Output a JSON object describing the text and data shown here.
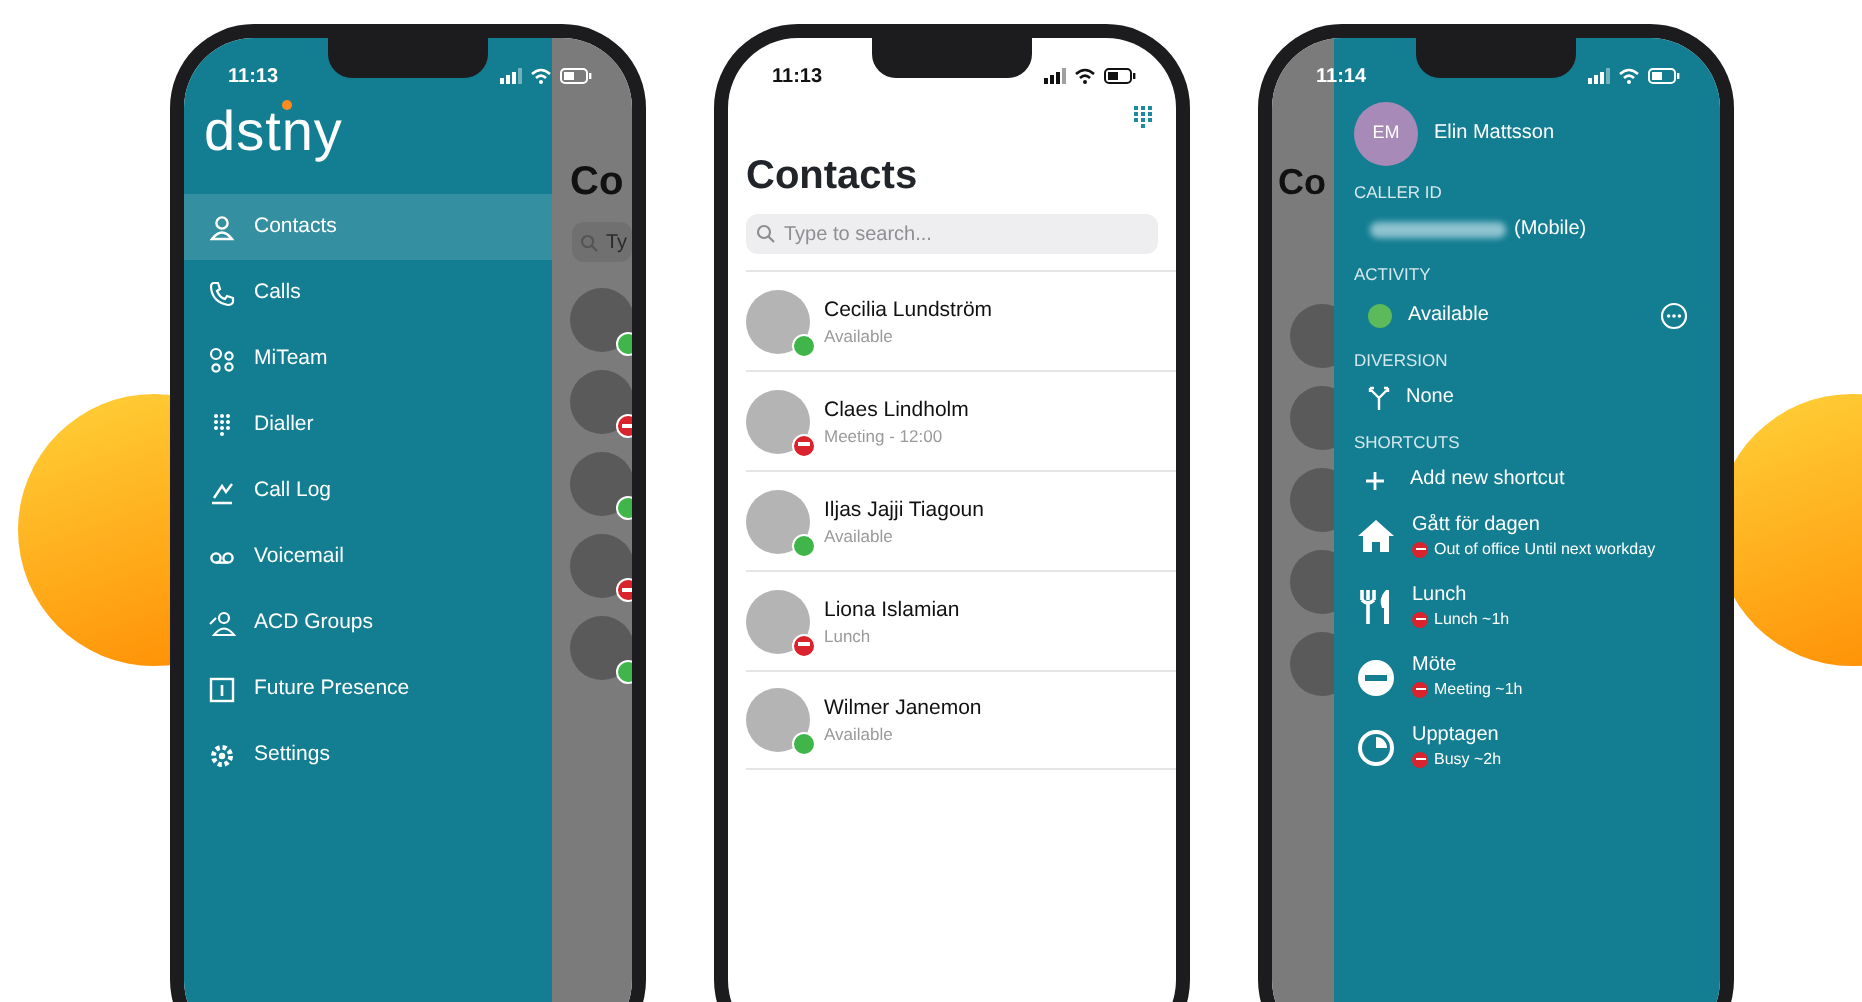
{
  "phones": [
    {
      "kind": "menu",
      "time": "11:13",
      "logo": "dstny",
      "menu": [
        {
          "kind": "person",
          "label": "Contacts",
          "selected": true
        },
        {
          "kind": "phone",
          "label": "Calls",
          "selected": false
        },
        {
          "kind": "team",
          "label": "MiTeam",
          "selected": false
        },
        {
          "kind": "keypad",
          "label": "Dialler",
          "selected": false
        },
        {
          "kind": "log",
          "label": "Call Log",
          "selected": false
        },
        {
          "kind": "voicemail",
          "label": "Voicemail",
          "selected": false
        },
        {
          "kind": "group",
          "label": "ACD Groups",
          "selected": false
        },
        {
          "kind": "calendar",
          "label": "Future Presence",
          "selected": false
        },
        {
          "kind": "gear",
          "label": "Settings",
          "selected": false
        }
      ],
      "behind": {
        "heading": "Co",
        "search": "Ty",
        "avatars": [
          {
            "kind": "photo",
            "busy": false
          },
          {
            "kind": "photo",
            "busy": true
          },
          {
            "kind": "photo",
            "busy": false
          },
          {
            "kind": "photo",
            "busy": true
          },
          {
            "kind": "photo",
            "busy": false
          }
        ]
      }
    },
    {
      "kind": "contacts",
      "time": "11:13",
      "title": "Contacts",
      "search": {
        "placeholder": "Type to search..."
      },
      "contacts": [
        {
          "name": "Cecilia Lundström",
          "status": "Available",
          "busy": false
        },
        {
          "name": "Claes Lindholm",
          "status": "Meeting - 12:00",
          "busy": true
        },
        {
          "name": "Iljas Jajji Tiagoun",
          "status": "Available",
          "busy": false
        },
        {
          "name": "Liona Islamian",
          "status": "Lunch",
          "busy": true
        },
        {
          "name": "Wilmer Janemon",
          "status": "Available",
          "busy": false
        }
      ]
    },
    {
      "kind": "profile",
      "time": "11:14",
      "behind": {
        "heading": "Co",
        "avatars": [
          {
            "kind": "photo"
          },
          {
            "kind": "photo"
          },
          {
            "kind": "photo"
          },
          {
            "kind": "photo"
          },
          {
            "kind": "photo"
          }
        ]
      },
      "user": {
        "initials": "EM",
        "name": "Elin Mattsson"
      },
      "caller_id": {
        "heading": "CALLER ID",
        "value": "(Mobile)"
      },
      "activity": {
        "heading": "ACTIVITY",
        "value": "Available",
        "busy": false
      },
      "diversion": {
        "heading": "DIVERSION",
        "value": "None"
      },
      "shortcuts": {
        "heading": "SHORTCUTS",
        "add": "Add new shortcut",
        "items": [
          {
            "kind": "house",
            "title": "Gått för dagen",
            "subtitle": "Out of office Until next workday",
            "busy": true
          },
          {
            "kind": "cutlery",
            "title": "Lunch",
            "subtitle": "Lunch ~1h",
            "busy": true
          },
          {
            "kind": "minus",
            "title": "Möte",
            "subtitle": "Meeting ~1h",
            "busy": true
          },
          {
            "kind": "clock",
            "title": "Upptagen",
            "subtitle": "Busy ~2h",
            "busy": true
          }
        ]
      }
    }
  ]
}
